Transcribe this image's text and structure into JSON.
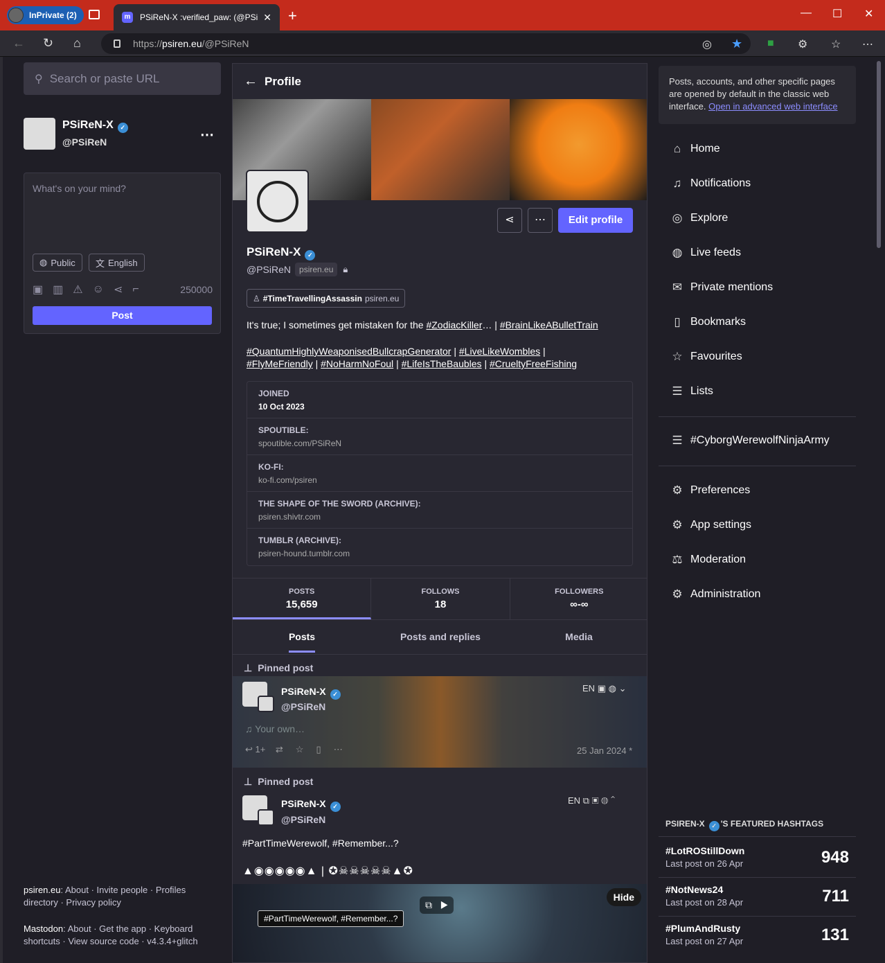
{
  "browser": {
    "inprivate_label": "InPrivate (2)",
    "tab_title": "PSiReN-X :verified_paw: (@PSiReN",
    "url_prefix": "https://",
    "url_host": "psiren.eu",
    "url_path": "/@PSiReN"
  },
  "left": {
    "search_placeholder": "Search or paste URL",
    "account_name": "PSiReN-X",
    "account_handle": "@PSiReN",
    "compose_placeholder": "What's on your mind?",
    "visibility": "Public",
    "language": "English",
    "char_count": "250000",
    "post_button": "Post",
    "footer1": {
      "site": "psiren.eu",
      "about": "About",
      "invite": "Invite people",
      "profiles": "Profiles directory",
      "privacy": "Privacy policy"
    },
    "footer2": {
      "mastodon": "Mastodon",
      "about": "About",
      "get_app": "Get the app",
      "shortcuts": "Keyboard shortcuts",
      "source": "View source code",
      "version": "v4.3.4+glitch"
    }
  },
  "profile": {
    "header": "Profile",
    "name": "PSiReN-X",
    "handle": "@PSiReN",
    "domain": "psiren.eu",
    "tag": "#TimeTravellingAssassin",
    "tag_domain": "psiren.eu",
    "edit_button": "Edit profile",
    "bio_line1_text": "It's true; I sometimes get mistaken for the",
    "bio_l1_a": "#ZodiacKiller",
    "bio_l1_sep": "… |",
    "bio_l1_b": "#BrainLikeABulletTrain",
    "bio_l2_a": "#QuantumHighlyWeaponisedBullcrapGenerator",
    "bio_l2_b": "#LiveLikeWombles",
    "bio_l3_a": "#FlyMeFriendly",
    "bio_l3_b": "#NoHarmNoFoul",
    "bio_l3_c": "#LifeIsTheBaubles",
    "bio_l3_d": "#CrueltyFreeFishing",
    "bar": "|",
    "fields": [
      {
        "key": "JOINED",
        "value": "10 Oct 2023"
      },
      {
        "key": "SPOUTIBLE:",
        "value": "spoutible.com/PSiReN"
      },
      {
        "key": "KO-FI:",
        "value": "ko-fi.com/psiren"
      },
      {
        "key": "THE SHAPE OF THE SWORD (ARCHIVE):",
        "value": "psiren.shivtr.com"
      },
      {
        "key": "TUMBLR (ARCHIVE):",
        "value": "psiren-hound.tumblr.com"
      }
    ],
    "stats": [
      {
        "label": "POSTS",
        "value": "15,659"
      },
      {
        "label": "FOLLOWS",
        "value": "18"
      },
      {
        "label": "FOLLOWERS",
        "value": "∞-∞"
      }
    ],
    "tabs": [
      "Posts",
      "Posts and replies",
      "Media"
    ]
  },
  "posts": [
    {
      "pinned": "Pinned post",
      "name": "PSiReN-X",
      "handle": "@PSiReN",
      "lang": "EN",
      "text": "Your own…",
      "boost_count": "1+",
      "date": "25 Jan 2024 *"
    },
    {
      "pinned": "Pinned post",
      "name": "PSiReN-X",
      "handle": "@PSiReN",
      "lang": "EN",
      "text": "#PartTimeWerewolf, #Remember...?",
      "hide": "Hide",
      "alt": "#PartTimeWerewolf, #Remember...?"
    }
  ],
  "right": {
    "notice": "Posts, accounts, and other specific pages are opened by default in the classic web interface.",
    "notice_link": "Open in advanced web interface",
    "nav": [
      {
        "label": "Home",
        "icon": "home-icon"
      },
      {
        "label": "Notifications",
        "icon": "bell-icon"
      },
      {
        "label": "Explore",
        "icon": "compass-icon"
      },
      {
        "label": "Live feeds",
        "icon": "globe-icon"
      },
      {
        "label": "Private mentions",
        "icon": "mail-icon"
      },
      {
        "label": "Bookmarks",
        "icon": "bookmark-icon"
      },
      {
        "label": "Favourites",
        "icon": "star-icon"
      },
      {
        "label": "Lists",
        "icon": "list-icon"
      }
    ],
    "list_item": "#CyborgWerewolfNinjaArmy",
    "nav2": [
      {
        "label": "Preferences",
        "icon": "gear-icon"
      },
      {
        "label": "App settings",
        "icon": "gears-icon"
      },
      {
        "label": "Moderation",
        "icon": "gavel-icon"
      },
      {
        "label": "Administration",
        "icon": "gears-icon"
      }
    ],
    "featured_prefix": "PSIREN-X",
    "featured_suffix": "'S FEATURED HASHTAGS",
    "hashtags": [
      {
        "tag": "#LotROStillDown",
        "last": "Last post on 26 Apr",
        "count": "948"
      },
      {
        "tag": "#NotNews24",
        "last": "Last post on 28 Apr",
        "count": "711"
      },
      {
        "tag": "#PlumAndRusty",
        "last": "Last post on 27 Apr",
        "count": "131"
      }
    ]
  }
}
